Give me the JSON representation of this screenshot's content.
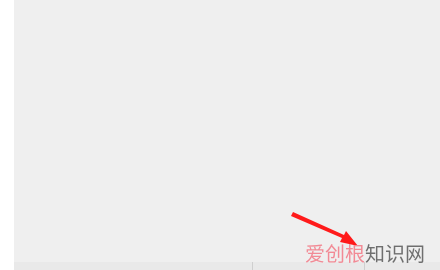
{
  "watermark": {
    "part1": "爱创根",
    "part2": "知识网",
    "accent_color": "#f28a95"
  },
  "bottom_bar": {
    "fragments": [
      "",
      "",
      ""
    ]
  },
  "annotation": {
    "icon": "red-arrow-icon",
    "color": "#ff1a1a"
  }
}
